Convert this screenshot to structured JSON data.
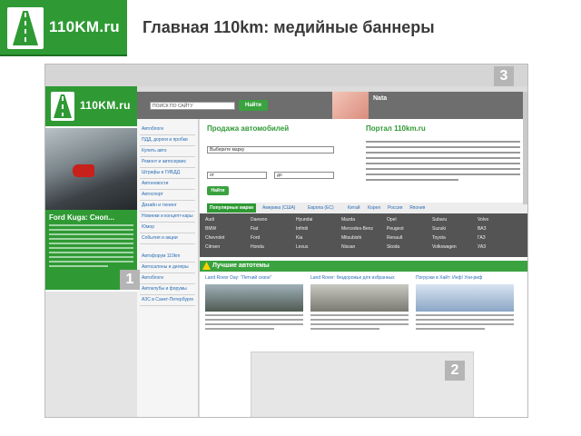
{
  "header": {
    "logo_text": "110KM.ru",
    "title": "Главная 110km: медийные баннеры"
  },
  "markers": [
    "1",
    "2",
    "3"
  ],
  "site": {
    "logo_text": "110KM.ru",
    "car_banner_title": "Ford Kuga: Сноп...",
    "search_placeholder": "ПОИСК ПО САЙТУ",
    "search_button": "Найти",
    "user_name": "Nata",
    "nav": [
      "Автоблоги",
      "ПДД, дороги и пробки",
      "Купить авто",
      "Ремонт и автосервис",
      "Штрафы и ГИБДД",
      "Автоновости",
      "Автоспорт",
      "Дизайн и тюнинг",
      "Новинки и концепт-кары",
      "Юмор",
      "События и акции",
      "Автофорум 110km",
      "Автосалоны и дилеры",
      "Автоблоги",
      "Автоклубы и форумы",
      "АЗС в Санкт-Петербурге"
    ],
    "sale": {
      "title": "Продажа автомобилей",
      "make_label": "Выберите марку",
      "price_from": "от",
      "price_to": "до",
      "find_button": "Найти"
    },
    "portal": {
      "title": "Портал 110km.ru"
    },
    "tabs": [
      "Популярные марки",
      "Америка (США)",
      "Европа (ЕС)",
      "Китай",
      "Корея",
      "Россия",
      "Япония"
    ],
    "brands": [
      "Audi",
      "BMW",
      "Chevrolet",
      "Citroen",
      "Daewoo",
      "Fiat",
      "Ford",
      "Honda",
      "Hyundai",
      "Infiniti",
      "Kia",
      "Lexus",
      "Mazda",
      "Mercedes-Benz",
      "Mitsubishi",
      "Nissan",
      "Opel",
      "Peugeot",
      "Renault",
      "Skoda",
      "Subaru",
      "Suzuki",
      "Toyota",
      "Volkswagen",
      "Volvo",
      "ВАЗ",
      "ГАЗ",
      "УАЗ"
    ],
    "best_label": "Лучшие автотемы",
    "topics": [
      "Land Rover Day: \"Летний сезон\"",
      "Land Rover: бездорожье для избранных",
      "Погрузки в Хайт: Инф! Уни-риф"
    ]
  },
  "colors": {
    "brand_green": "#2f9a34",
    "dark_bar": "#545454",
    "link_blue": "#2a6db5"
  }
}
